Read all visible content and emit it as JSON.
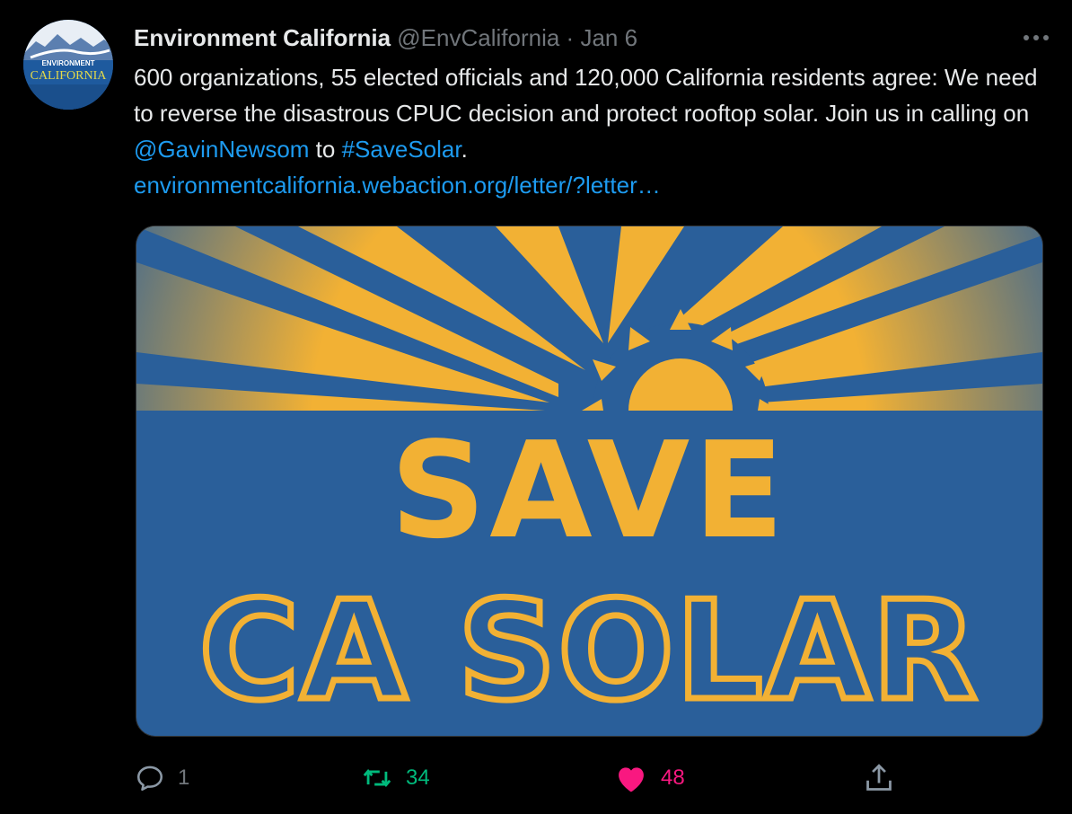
{
  "account": {
    "display_name": "Environment California",
    "handle": "@EnvCalifornia",
    "separator": "·",
    "date": "Jan 6",
    "avatar_text_top": "ENVIRONMENT",
    "avatar_text_bottom": "CALIFORNIA"
  },
  "tweet": {
    "text_part1": "600 organizations, 55 elected officials and 120,000 California residents agree: We need to reverse the disastrous CPUC decision and protect rooftop solar. Join us in calling on ",
    "mention": "@GavinNewsom",
    "text_part2": " to ",
    "hashtag": "#SaveSolar",
    "text_part3": ".",
    "url": "environmentcalifornia.webaction.org/letter/?letter…"
  },
  "media": {
    "line1": "SAVE",
    "line2": "CA SOLAR"
  },
  "actions": {
    "reply_count": "1",
    "retweet_count": "34",
    "like_count": "48"
  },
  "colors": {
    "background": "#000000",
    "link": "#1d9bf0",
    "muted": "#71767b",
    "retweet": "#00ba7c",
    "like": "#f91880",
    "banner_blue": "#2a5f9a",
    "banner_gold": "#f2b134"
  },
  "icons": {
    "more": "more-icon",
    "reply": "reply-icon",
    "retweet": "retweet-icon",
    "like": "heart-icon",
    "share": "share-icon"
  }
}
